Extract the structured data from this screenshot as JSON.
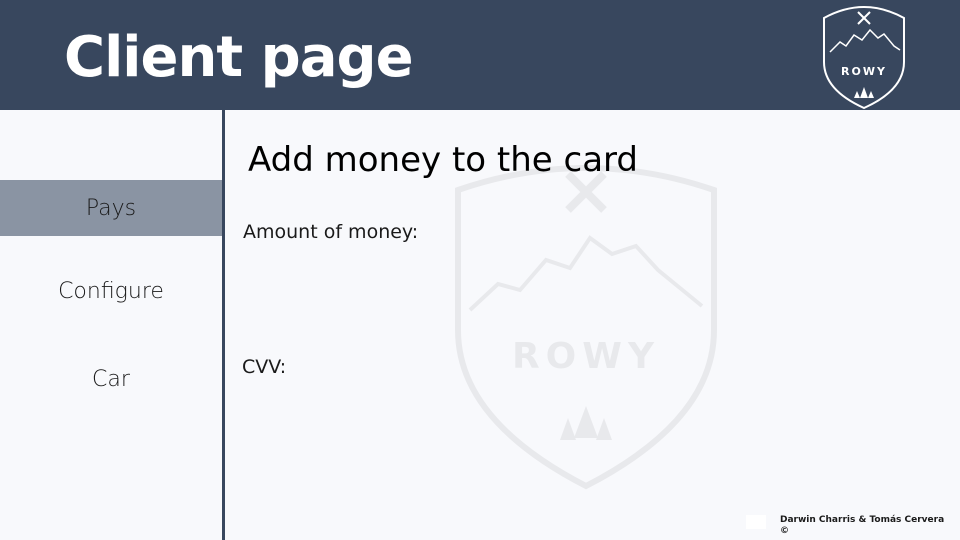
{
  "header": {
    "title": "Client page",
    "logo_text": "ROWY"
  },
  "sidebar": {
    "items": [
      {
        "label": "Pays",
        "active": true
      },
      {
        "label": "Configure",
        "active": false
      },
      {
        "label": "Car",
        "active": false
      }
    ]
  },
  "main": {
    "title": "Add money to the card",
    "fields": [
      {
        "label": "Amount of money:"
      },
      {
        "label": "CVV:"
      }
    ]
  },
  "watermark": {
    "text": "ROWY"
  },
  "footer": {
    "credit": "Darwin Charris & Tomás Cervera ©"
  },
  "colors": {
    "header_bg": "#38475e",
    "active_item_bg": "#8a94a3",
    "page_bg": "#f8f9fc"
  }
}
